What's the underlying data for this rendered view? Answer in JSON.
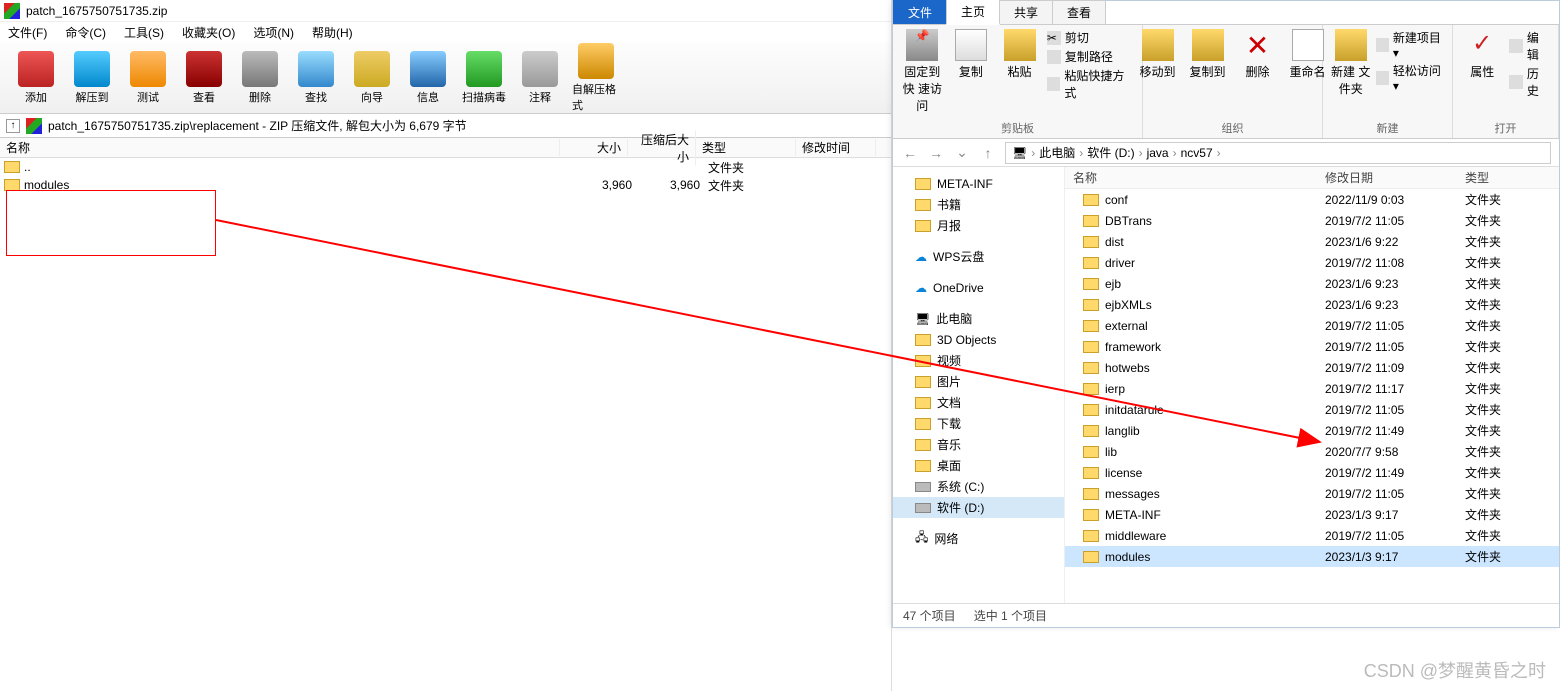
{
  "winrar": {
    "title": "patch_1675750751735.zip",
    "menu": [
      "文件(F)",
      "命令(C)",
      "工具(S)",
      "收藏夹(O)",
      "选项(N)",
      "帮助(H)"
    ],
    "toolbar": [
      {
        "label": "添加",
        "color": "linear-gradient(#e55,#b22)"
      },
      {
        "label": "解压到",
        "color": "linear-gradient(#5cf,#08c)"
      },
      {
        "label": "测试",
        "color": "linear-gradient(#fb6,#e80)"
      },
      {
        "label": "查看",
        "color": "linear-gradient(#c33,#800)"
      },
      {
        "label": "删除",
        "color": "linear-gradient(#bbb,#777)"
      },
      {
        "label": "查找",
        "color": "linear-gradient(#9df,#38c)"
      },
      {
        "label": "向导",
        "color": "linear-gradient(#ec6,#ca2)"
      },
      {
        "label": "信息",
        "color": "linear-gradient(#8cf,#26a)"
      },
      {
        "label": "扫描病毒",
        "color": "linear-gradient(#6d6,#292)"
      },
      {
        "label": "注释",
        "color": "linear-gradient(#ccc,#999)"
      },
      {
        "label": "自解压格式",
        "color": "linear-gradient(#fc6,#c80)"
      }
    ],
    "up_arrow": "↑",
    "path": "patch_1675750751735.zip\\replacement - ZIP 压缩文件, 解包大小为 6,679 字节",
    "columns": {
      "name": "名称",
      "size": "大小",
      "packed": "压缩后大小",
      "type": "类型",
      "date": "修改时间"
    },
    "rows": [
      {
        "name": "..",
        "size": "",
        "packed": "",
        "type": "文件夹",
        "date": ""
      },
      {
        "name": "modules",
        "size": "3,960",
        "packed": "3,960",
        "type": "文件夹",
        "date": ""
      }
    ]
  },
  "explorer": {
    "tabs": {
      "file": "文件",
      "home": "主页",
      "share": "共享",
      "view": "查看"
    },
    "ribbon": {
      "clipboard": {
        "label": "剪贴板",
        "pin": "固定到快\n速访问",
        "copy": "复制",
        "paste": "粘贴",
        "cut": "剪切",
        "copypath": "复制路径",
        "pasteshort": "粘贴快捷方式"
      },
      "organize": {
        "label": "组织",
        "moveto": "移动到",
        "copyto": "复制到",
        "delete": "删除",
        "rename": "重命名"
      },
      "new": {
        "label": "新建",
        "newfolder": "新建\n文件夹",
        "newitem": "新建项目 ▾",
        "easyaccess": "轻松访问 ▾"
      },
      "open": {
        "label": "打开",
        "properties": "属性",
        "edit": "编辑",
        "history": "历史"
      }
    },
    "nav": {
      "back": "←",
      "fwd": "→",
      "down": "⌄",
      "up": "↑"
    },
    "crumbs": [
      "此电脑",
      "软件 (D:)",
      "java",
      "ncv57"
    ],
    "side": [
      {
        "name": "META-INF",
        "icon": "folder",
        "cls": ""
      },
      {
        "name": "书籍",
        "icon": "folder",
        "cls": ""
      },
      {
        "name": "月报",
        "icon": "folder",
        "cls": ""
      },
      {
        "sep": true
      },
      {
        "name": "WPS云盘",
        "icon": "cloud",
        "cls": ""
      },
      {
        "sep": true
      },
      {
        "name": "OneDrive",
        "icon": "cloud",
        "cls": ""
      },
      {
        "sep": true
      },
      {
        "name": "此电脑",
        "icon": "pc",
        "cls": ""
      },
      {
        "name": "3D Objects",
        "icon": "folder",
        "cls": ""
      },
      {
        "name": "视频",
        "icon": "folder",
        "cls": ""
      },
      {
        "name": "图片",
        "icon": "folder",
        "cls": ""
      },
      {
        "name": "文档",
        "icon": "folder",
        "cls": ""
      },
      {
        "name": "下载",
        "icon": "folder",
        "cls": ""
      },
      {
        "name": "音乐",
        "icon": "folder",
        "cls": ""
      },
      {
        "name": "桌面",
        "icon": "folder",
        "cls": ""
      },
      {
        "name": "系统 (C:)",
        "icon": "disk",
        "cls": ""
      },
      {
        "name": "软件 (D:)",
        "icon": "disk",
        "cls": "sel"
      },
      {
        "sep": true
      },
      {
        "name": "网络",
        "icon": "net",
        "cls": ""
      }
    ],
    "list_hdr": {
      "name": "名称",
      "date": "修改日期",
      "type": "类型"
    },
    "files": [
      {
        "name": "conf",
        "date": "2022/11/9 0:03",
        "type": "文件夹"
      },
      {
        "name": "DBTrans",
        "date": "2019/7/2 11:05",
        "type": "文件夹"
      },
      {
        "name": "dist",
        "date": "2023/1/6 9:22",
        "type": "文件夹"
      },
      {
        "name": "driver",
        "date": "2019/7/2 11:08",
        "type": "文件夹"
      },
      {
        "name": "ejb",
        "date": "2023/1/6 9:23",
        "type": "文件夹"
      },
      {
        "name": "ejbXMLs",
        "date": "2023/1/6 9:23",
        "type": "文件夹"
      },
      {
        "name": "external",
        "date": "2019/7/2 11:05",
        "type": "文件夹"
      },
      {
        "name": "framework",
        "date": "2019/7/2 11:05",
        "type": "文件夹"
      },
      {
        "name": "hotwebs",
        "date": "2019/7/2 11:09",
        "type": "文件夹"
      },
      {
        "name": "ierp",
        "date": "2019/7/2 11:17",
        "type": "文件夹"
      },
      {
        "name": "initdatarule",
        "date": "2019/7/2 11:05",
        "type": "文件夹"
      },
      {
        "name": "langlib",
        "date": "2019/7/2 11:49",
        "type": "文件夹"
      },
      {
        "name": "lib",
        "date": "2020/7/7 9:58",
        "type": "文件夹"
      },
      {
        "name": "license",
        "date": "2019/7/2 11:49",
        "type": "文件夹"
      },
      {
        "name": "messages",
        "date": "2019/7/2 11:05",
        "type": "文件夹"
      },
      {
        "name": "META-INF",
        "date": "2023/1/3 9:17",
        "type": "文件夹"
      },
      {
        "name": "middleware",
        "date": "2019/7/2 11:05",
        "type": "文件夹"
      },
      {
        "name": "modules",
        "date": "2023/1/3 9:17",
        "type": "文件夹",
        "sel": true
      }
    ],
    "status": {
      "count": "47 个项目",
      "selected": "选中 1 个项目"
    }
  },
  "watermark": "CSDN @梦醒黄昏之时"
}
